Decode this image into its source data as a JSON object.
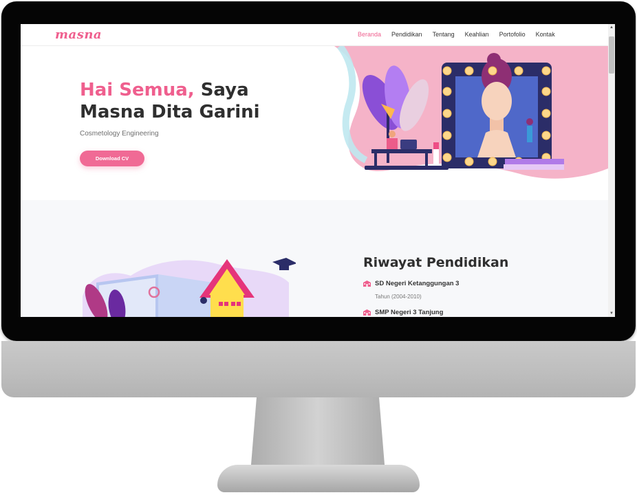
{
  "nav": {
    "brand": "masna",
    "links": [
      "Beranda",
      "Pendidikan",
      "Tentang",
      "Keahlian",
      "Portofolio",
      "Kontak"
    ]
  },
  "hero": {
    "title_accent": "Hai Semua,",
    "title_rest": " Saya Masna Dita Garini",
    "subtitle": "Cosmetology Engineering",
    "cta": "Download CV"
  },
  "education": {
    "title": "Riwayat Pendidikan",
    "items": [
      {
        "school": "SD Negeri Ketanggungan 3",
        "year": "Tahun (2004-2010)"
      },
      {
        "school": "SMP Negeri 3 Tanjung",
        "year": ""
      }
    ]
  },
  "icons": {
    "scroll_up": "scroll-up-arrow-icon",
    "scroll_down": "scroll-down-arrow-icon",
    "school": "school-building-icon"
  },
  "colors": {
    "accent": "#ef5f8e",
    "button": "#f06a95",
    "text": "#2f2f2f",
    "section_bg": "#f7f8fa",
    "monitor_bezel": "#050505",
    "monitor_body": "#c2c2c2"
  }
}
